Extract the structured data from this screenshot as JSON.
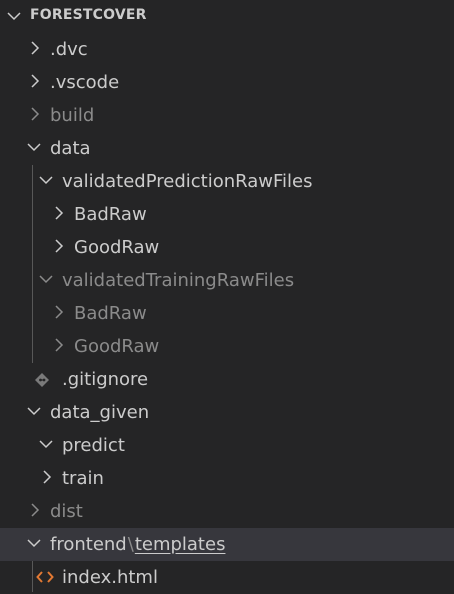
{
  "explorer": {
    "root": {
      "label": "FORESTCOVER",
      "expanded": true
    },
    "items": [
      {
        "label": ".dvc",
        "type": "folder",
        "expanded": false,
        "dim": false
      },
      {
        "label": ".vscode",
        "type": "folder",
        "expanded": false,
        "dim": false
      },
      {
        "label": "build",
        "type": "folder",
        "expanded": false,
        "dim": true
      },
      {
        "label": "data",
        "type": "folder",
        "expanded": true,
        "dim": false
      },
      {
        "label": "validatedPredictionRawFiles",
        "type": "folder",
        "expanded": true,
        "dim": false
      },
      {
        "label": "BadRaw",
        "type": "folder",
        "expanded": false,
        "dim": false
      },
      {
        "label": "GoodRaw",
        "type": "folder",
        "expanded": false,
        "dim": false
      },
      {
        "label": "validatedTrainingRawFiles",
        "type": "folder",
        "expanded": true,
        "dim": true
      },
      {
        "label": "BadRaw",
        "type": "folder",
        "expanded": false,
        "dim": true
      },
      {
        "label": "GoodRaw",
        "type": "folder",
        "expanded": false,
        "dim": true
      },
      {
        "label": ".gitignore",
        "type": "file",
        "icon": "git-diamond-icon",
        "dim": false
      },
      {
        "label": "data_given",
        "type": "folder",
        "expanded": true,
        "dim": false
      },
      {
        "label": "predict",
        "type": "folder",
        "expanded": true,
        "dim": false
      },
      {
        "label": "train",
        "type": "folder",
        "expanded": false,
        "dim": false
      },
      {
        "label": "dist",
        "type": "folder",
        "expanded": false,
        "dim": true
      },
      {
        "label_part1": "frontend",
        "separator": "\\",
        "label_part2": "templates",
        "type": "folder",
        "expanded": true,
        "dim": false,
        "selected": true
      },
      {
        "label": "index.html",
        "type": "file",
        "icon": "html-code-icon",
        "dim": false
      }
    ],
    "colors": {
      "background": "#252526",
      "selected_row": "#37373d",
      "text": "#cccccc",
      "dim_text": "#8b8b8b",
      "html_icon": "#e37933",
      "git_icon": "#8b8b8b"
    }
  }
}
